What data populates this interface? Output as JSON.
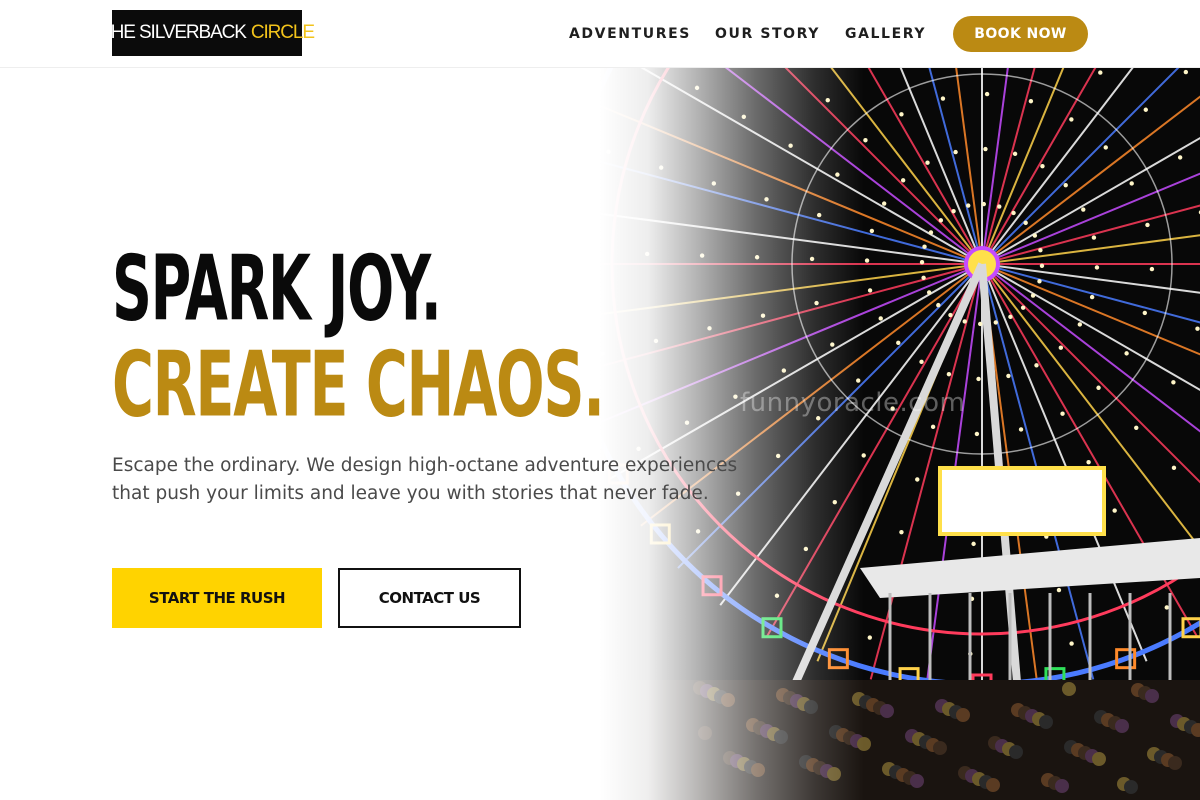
{
  "header": {
    "logo_main": "THE SILVERBACK",
    "logo_accent": "CIRCLE",
    "nav": [
      {
        "label": "ADVENTURES"
      },
      {
        "label": "OUR STORY"
      },
      {
        "label": "GALLERY"
      }
    ],
    "book_label": "BOOK NOW"
  },
  "hero": {
    "headline_line1": "SPARK JOY.",
    "headline_line2": "CREATE CHAOS.",
    "subtitle": "Escape the ordinary. We design high-octane adventure experiences that push your limits and leave you with stories that never fade.",
    "primary_cta": "START THE RUSH",
    "secondary_cta": "CONTACT US",
    "image_watermark": "funnyoracle.com"
  },
  "colors": {
    "accent_gold": "#bb8a13",
    "cta_yellow": "#ffd300",
    "logo_accent": "#f2c31b",
    "text_dark": "#0a0a0a"
  }
}
